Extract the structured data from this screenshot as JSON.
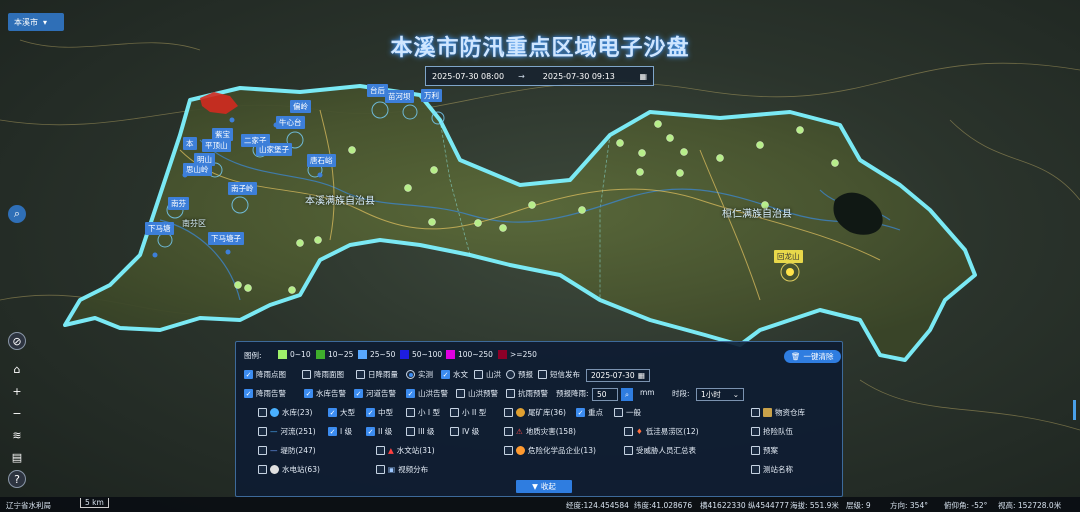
{
  "header": {
    "city_select": "本溪市",
    "title": "本溪市防汛重点区域电子沙盘",
    "time_start": "2025-07-30 08:00",
    "time_end": "2025-07-30 09:13"
  },
  "map": {
    "region_labels": [
      "本溪满族自治县",
      "桓仁满族自治县",
      "南芬区"
    ],
    "station_labels": [
      "台后",
      "苗河坝",
      "万利",
      "偏岭",
      "牛心台",
      "紫宝",
      "本",
      "平顶山",
      "二家子",
      "山家堡子",
      "唐石峪",
      "明山",
      "思山岭",
      "南子岭",
      "南芬",
      "下马塘",
      "下马塘子",
      "回龙山"
    ],
    "colors": {
      "boundary": "#7ff3ff",
      "highlight_red": "#d12a1f",
      "label_blue": "#3d7fd9"
    }
  },
  "legend": {
    "title": "图例:",
    "rain_scale": [
      {
        "label": "0~10",
        "color": "#9ef06a"
      },
      {
        "label": "10~25",
        "color": "#3fae2c"
      },
      {
        "label": "25~50",
        "color": "#58a8ff"
      },
      {
        "label": "50~100",
        "color": "#1d1de0"
      },
      {
        "label": "100~250",
        "color": "#e000e0"
      },
      {
        "label": ">=250",
        "color": "#8c0028"
      }
    ],
    "clear_button": "一键清除",
    "row2": {
      "rain_point": "降雨点图",
      "rain_surface": "降雨面图",
      "daily_rain": "日降雨量",
      "realtime": "实测",
      "hydro": "水文",
      "mountain_flood": "山洪",
      "forecast": "预报",
      "sms": "短信发布",
      "date": "2025-07-30"
    },
    "row3": {
      "rain_alert": "降雨告警",
      "reservoir_alert": "水库告警",
      "river_alert": "河道告警",
      "flood_alert": "山洪告警",
      "flood_forecast": "山洪预警",
      "flood_rain": "抗雨预警",
      "forecast_rain_label": "预报降雨:",
      "forecast_rain_value": "50",
      "unit": "mm",
      "period_label": "时段:",
      "period_value": "1小时"
    },
    "row4": {
      "reservoir": "水库(23)",
      "large": "大型",
      "medium": "中型",
      "small1": "小 I 型",
      "small2": "小 II 型",
      "tailings": "尾矿库(36)",
      "key": "重点",
      "general": "一般",
      "warehouse": "物资仓库"
    },
    "row5": {
      "river": "河流(251)",
      "grade1": "I 级",
      "grade2": "II 级",
      "grade3": "III 级",
      "grade4": "IV 级",
      "geo_hazard": "地质灾害(158)",
      "lowland": "低洼易涝区(12)",
      "rescue_team": "抢险队伍"
    },
    "row6": {
      "dike": "堤防(247)",
      "hydro_station": "水文站(31)",
      "hazmat": "危险化学品企业(13)",
      "threatened": "受威胁人员汇总表",
      "plan": "预案"
    },
    "row7": {
      "hydropower": "水电站(63)",
      "video": "视频分布",
      "test_name": "测站名称"
    },
    "collapse": "收起"
  },
  "status_bar": {
    "source": "辽宁省水利局",
    "scale": "5 km",
    "lon": "经度:124.454584",
    "lat": "纬度:41.028676",
    "xy": "横41622330 纵4544777",
    "alt": "海拔: 551.9米",
    "level": "层级: 9",
    "heading": "方向: 354°",
    "pitch": "俯仰角: -52°",
    "view_height": "视高: 152728.0米"
  }
}
